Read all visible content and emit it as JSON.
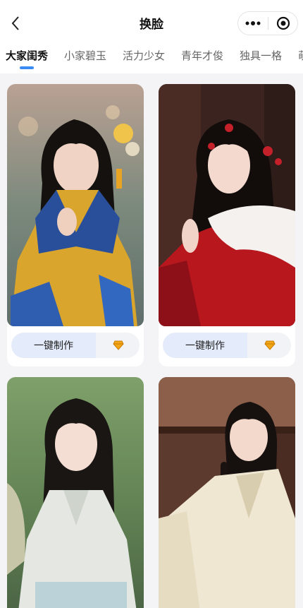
{
  "header": {
    "title": "换脸",
    "back_icon": "chevron-left-icon",
    "more_icon": "more-dots-icon",
    "target_icon": "target-icon"
  },
  "tabs": [
    {
      "label": "大家闺秀",
      "active": true
    },
    {
      "label": "小家碧玉",
      "active": false
    },
    {
      "label": "活力少女",
      "active": false
    },
    {
      "label": "青年才俊",
      "active": false
    },
    {
      "label": "独具一格",
      "active": false
    },
    {
      "label": "萌",
      "active": false
    }
  ],
  "cards": [
    {
      "action_label": "一键制作",
      "premium_icon": "diamond-icon"
    },
    {
      "action_label": "一键制作",
      "premium_icon": "diamond-icon"
    },
    {
      "action_label": "",
      "premium_icon": ""
    },
    {
      "action_label": "",
      "premium_icon": ""
    }
  ],
  "colors": {
    "accent": "#3a8cf4",
    "diamond": "#f2a516",
    "button_bg": "#e4ebfb",
    "page_bg": "#f4f4f6"
  }
}
